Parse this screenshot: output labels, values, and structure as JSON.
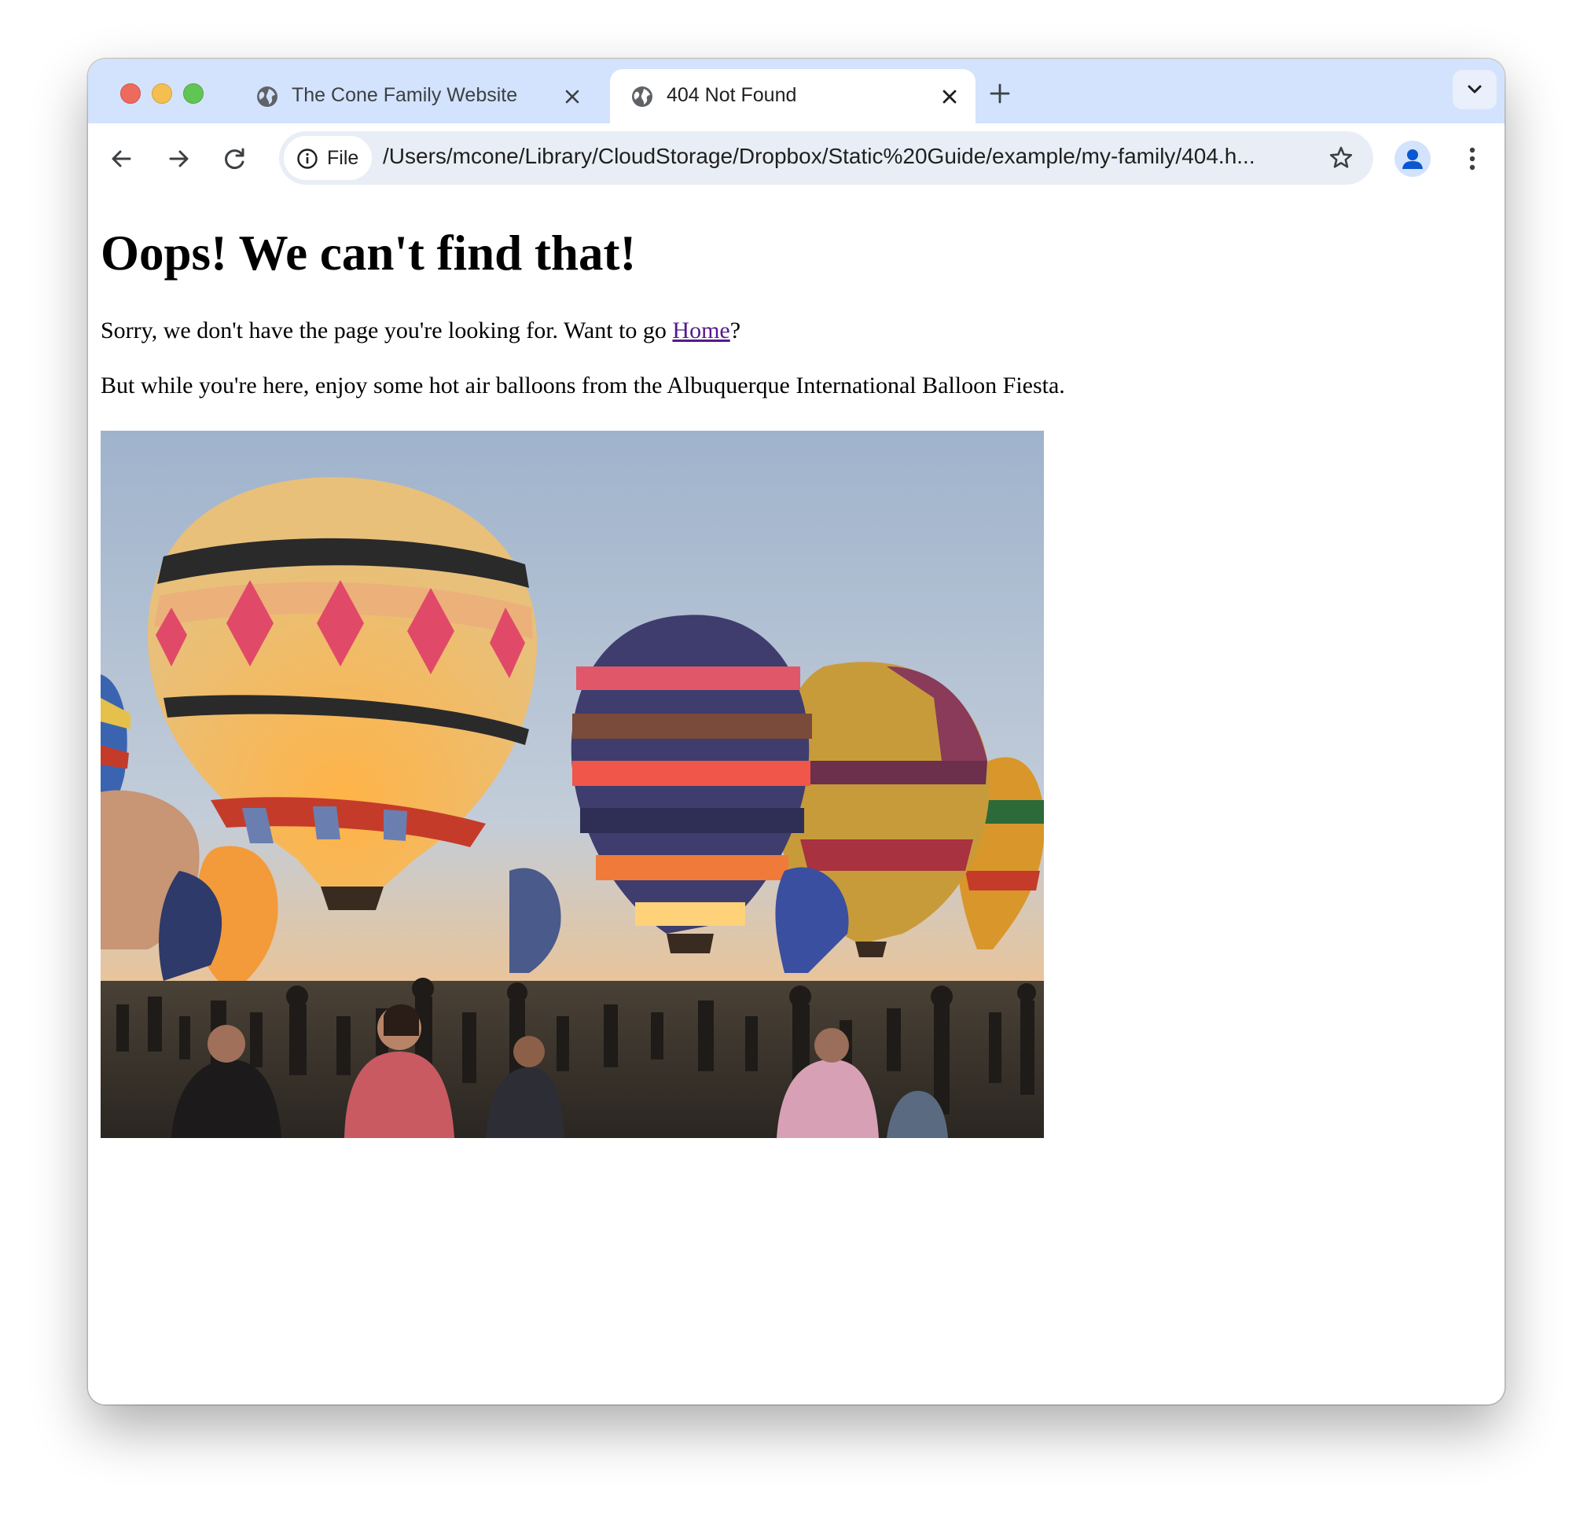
{
  "browser": {
    "tabs": [
      {
        "title": "The Cone Family Website",
        "active": false
      },
      {
        "title": "404 Not Found",
        "active": true
      }
    ],
    "omnibox": {
      "scheme_chip": "File",
      "url": "/Users/mcone/Library/CloudStorage/Dropbox/Static%20Guide/example/my-family/404.h..."
    },
    "accent_color": "#d3e3fd"
  },
  "page": {
    "heading": "Oops! We can't find that!",
    "p1_before": "Sorry, we don't have the page you're looking for. Want to go ",
    "p1_link": "Home",
    "p1_after": "?",
    "p2": "But while you're here, enjoy some hot air balloons from the Albuquerque International Balloon Fiesta.",
    "link_color": "#551a8b"
  }
}
